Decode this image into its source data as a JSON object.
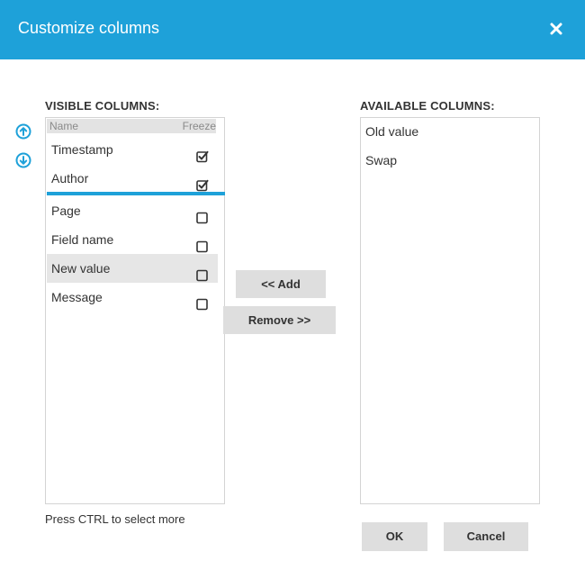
{
  "dialog": {
    "title": "Customize columns",
    "close_icon": "close-icon",
    "accent_color": "#1ea1d9"
  },
  "visible": {
    "label": "VISIBLE COLUMNS:",
    "header_name": "Name",
    "header_freeze": "Freeze",
    "rows": [
      {
        "label": "Timestamp",
        "frozen": true,
        "selected": false
      },
      {
        "label": "Author",
        "frozen": true,
        "selected": false
      },
      {
        "label": "Page",
        "frozen": false,
        "selected": false
      },
      {
        "label": "Field name",
        "frozen": false,
        "selected": false
      },
      {
        "label": "New value",
        "frozen": false,
        "selected": true
      },
      {
        "label": "Message",
        "frozen": false,
        "selected": false
      }
    ]
  },
  "available": {
    "label": "AVAILABLE COLUMNS:",
    "items": [
      "Old value",
      "Swap"
    ]
  },
  "reorder": {
    "up_icon": "arrow-up-circle-icon",
    "down_icon": "arrow-down-circle-icon"
  },
  "actions": {
    "add_label": "<<  Add",
    "remove_label": "Remove  >>",
    "ok_label": "OK",
    "cancel_label": "Cancel"
  },
  "hint": "Press CTRL to select more"
}
